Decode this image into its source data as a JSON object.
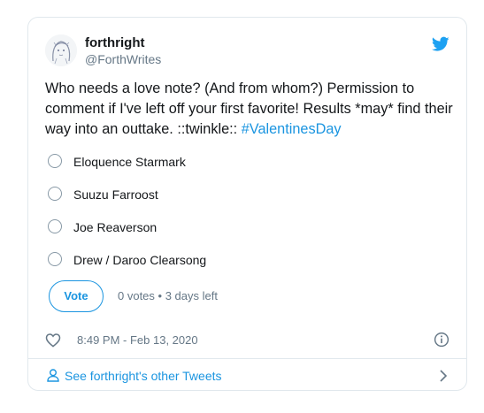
{
  "user": {
    "display_name": "forthright",
    "handle": "@ForthWrites",
    "avatar_icon": "avatar-sketch"
  },
  "tweet": {
    "text": "Who needs a love note? (And from whom?) Permission to comment if I've left off your first favorite! Results *may* find their way into an outtake. ::twinkle:: ",
    "hashtag": "#ValentinesDay"
  },
  "poll": {
    "options": [
      {
        "label": "Eloquence Starmark"
      },
      {
        "label": "Suuzu Farroost"
      },
      {
        "label": "Joe Reaverson"
      },
      {
        "label": "Drew / Daroo Clearsong"
      }
    ],
    "vote_label": "Vote",
    "meta": "0 votes • 3 days left"
  },
  "meta": {
    "timestamp": "8:49 PM - Feb 13, 2020"
  },
  "footer": {
    "label": "See forthright's other Tweets"
  },
  "colors": {
    "accent": "#1b95e0",
    "muted": "#657786",
    "text": "#14171a",
    "border": "#e1e8ed"
  },
  "icons": [
    "twitter-bird-icon",
    "heart-icon",
    "info-icon",
    "person-icon",
    "chevron-right-icon"
  ]
}
